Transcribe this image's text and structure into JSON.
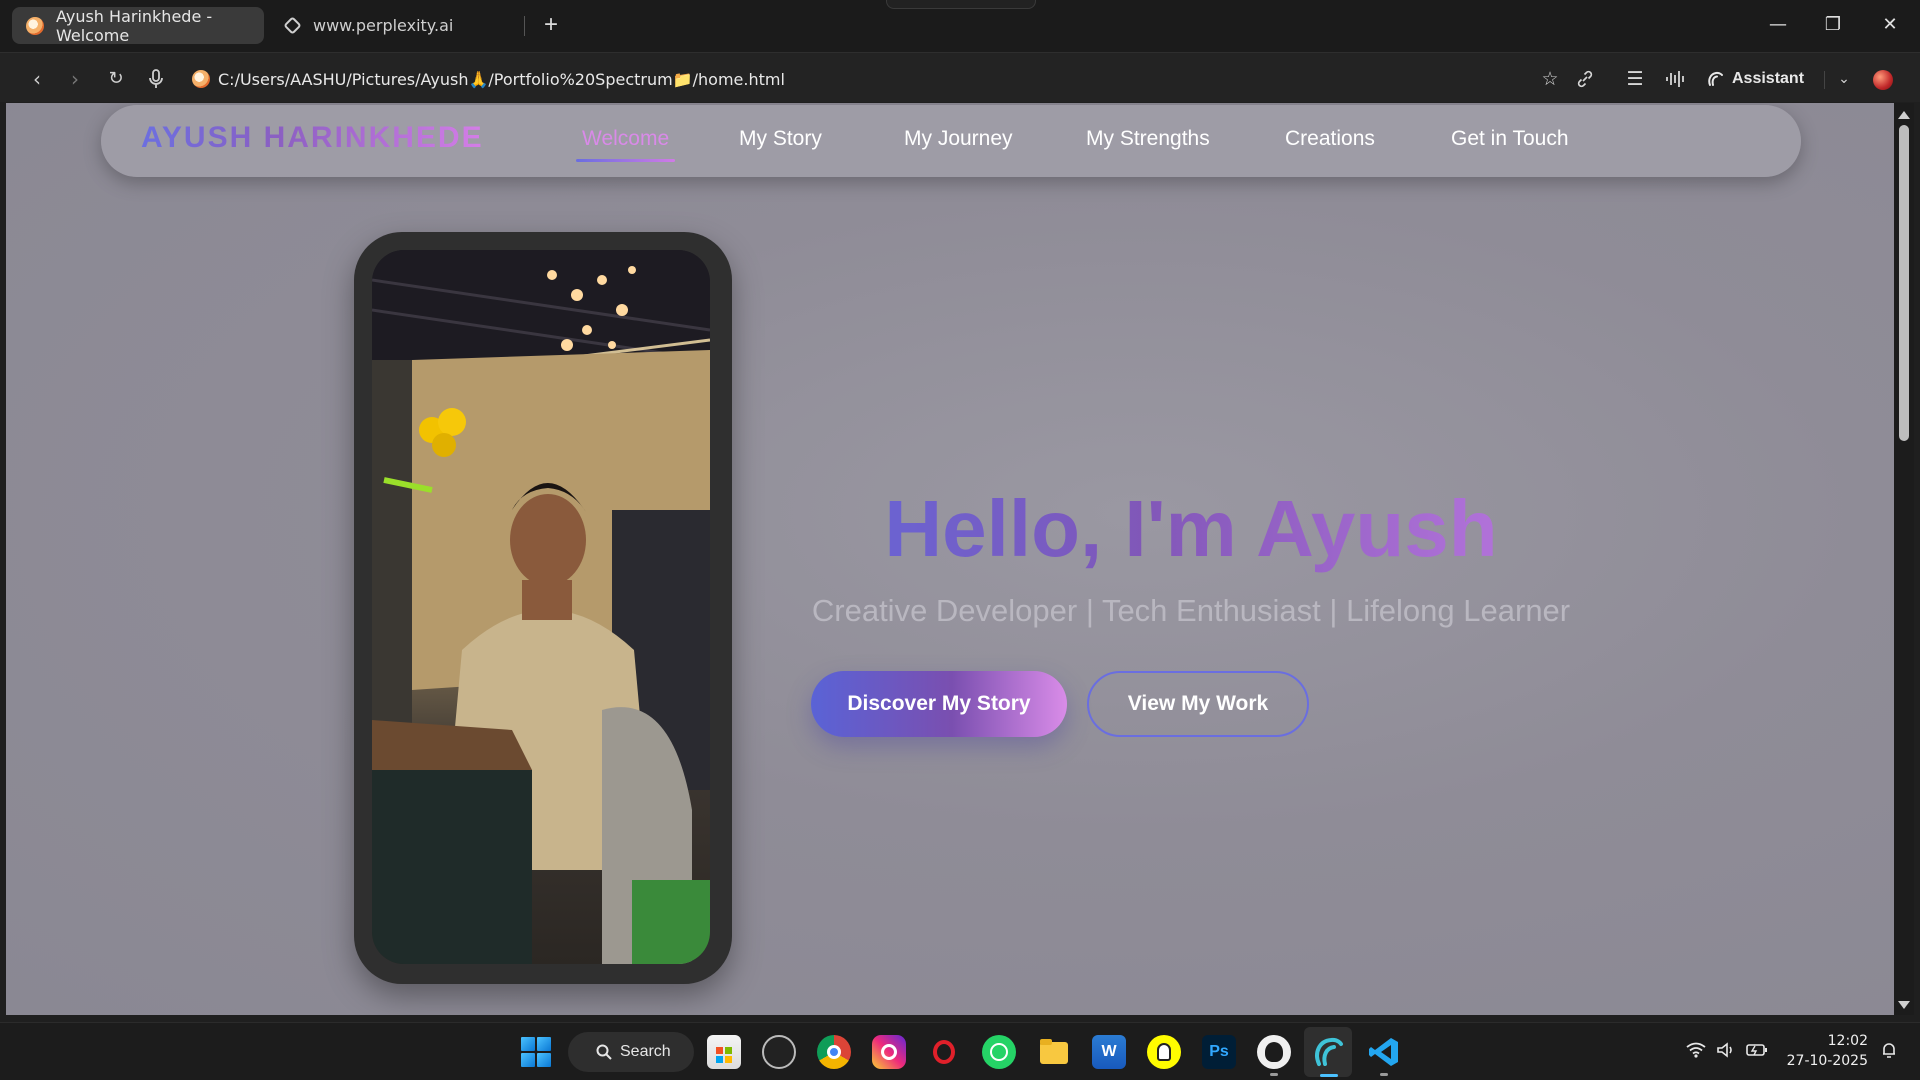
{
  "browser": {
    "tabs": [
      {
        "title": "Ayush Harinkhede - Welcome",
        "active": true
      },
      {
        "title": "www.perplexity.ai",
        "active": false
      }
    ],
    "url": {
      "part1": "C:/Users/AASHU/Pictures/Ayush",
      "emoji1": "🙏",
      "part2": "/Portfolio%20Spectrum",
      "emoji2": "📁",
      "part3": "/home.html"
    },
    "assistant_label": "Assistant"
  },
  "site": {
    "logo": "AYUSH HARINKHEDE",
    "nav": [
      "Welcome",
      "My Story",
      "My Journey",
      "My Strengths",
      "Creations",
      "Get in Touch"
    ],
    "active_nav": "Welcome",
    "hero": {
      "title": "Hello, I'm Ayush",
      "subtitle": "Creative Developer | Tech Enthusiast | Lifelong Learner",
      "primary_button": "Discover My Story",
      "secondary_button": "View My Work"
    },
    "colors": {
      "accent_start": "#5e6ae0",
      "accent_mid": "#8157b8",
      "accent_end": "#c77ee8"
    }
  },
  "taskbar": {
    "search_label": "Search",
    "apps": [
      "microsoft-store-icon",
      "notion-icon",
      "chrome-icon",
      "instagram-icon",
      "opera-icon",
      "whatsapp-icon",
      "file-explorer-icon",
      "word-icon",
      "snapchat-icon",
      "photoshop-icon",
      "github-icon",
      "comet-browser-icon",
      "vscode-icon"
    ],
    "photoshop_text": "Ps",
    "time": "12:02",
    "date": "27-10-2025"
  }
}
